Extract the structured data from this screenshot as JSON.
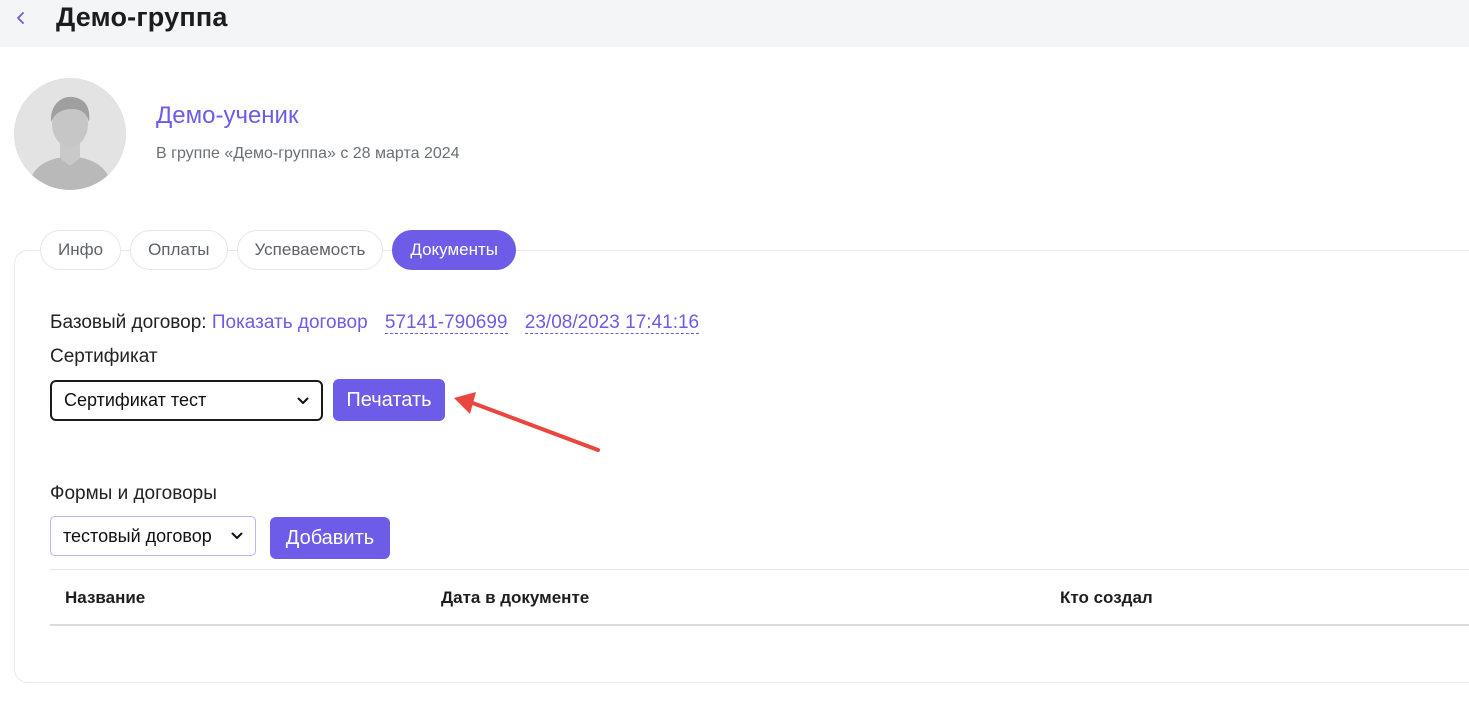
{
  "header": {
    "title": "Демо-группа",
    "back_icon": "chevron-left-icon"
  },
  "student": {
    "name": "Демо-ученик",
    "subtitle": "В группе «Демо-группа» с 28 марта 2024",
    "avatar_icon": "user-avatar-icon"
  },
  "tabs": [
    {
      "label": "Инфо",
      "active": false
    },
    {
      "label": "Оплаты",
      "active": false
    },
    {
      "label": "Успеваемость",
      "active": false
    },
    {
      "label": "Документы",
      "active": true
    }
  ],
  "documents": {
    "base_contract_label": "Базовый договор:",
    "show_contract_link": "Показать договор",
    "contract_number": "57141-790699",
    "contract_datetime": "23/08/2023 17:41:16",
    "certificate_label": "Сертификат",
    "certificate_selected": "Сертификат тест",
    "print_button": "Печатать",
    "forms_label": "Формы и договоры",
    "forms_selected": "тестовый договор",
    "add_button": "Добавить"
  },
  "table": {
    "columns": [
      "Название",
      "Дата в документе",
      "Кто создал"
    ],
    "rows": []
  },
  "colors": {
    "accent": "#6c5ce7",
    "annotation_arrow": "#e8463f",
    "topbar_bg": "#f4f5f7"
  }
}
